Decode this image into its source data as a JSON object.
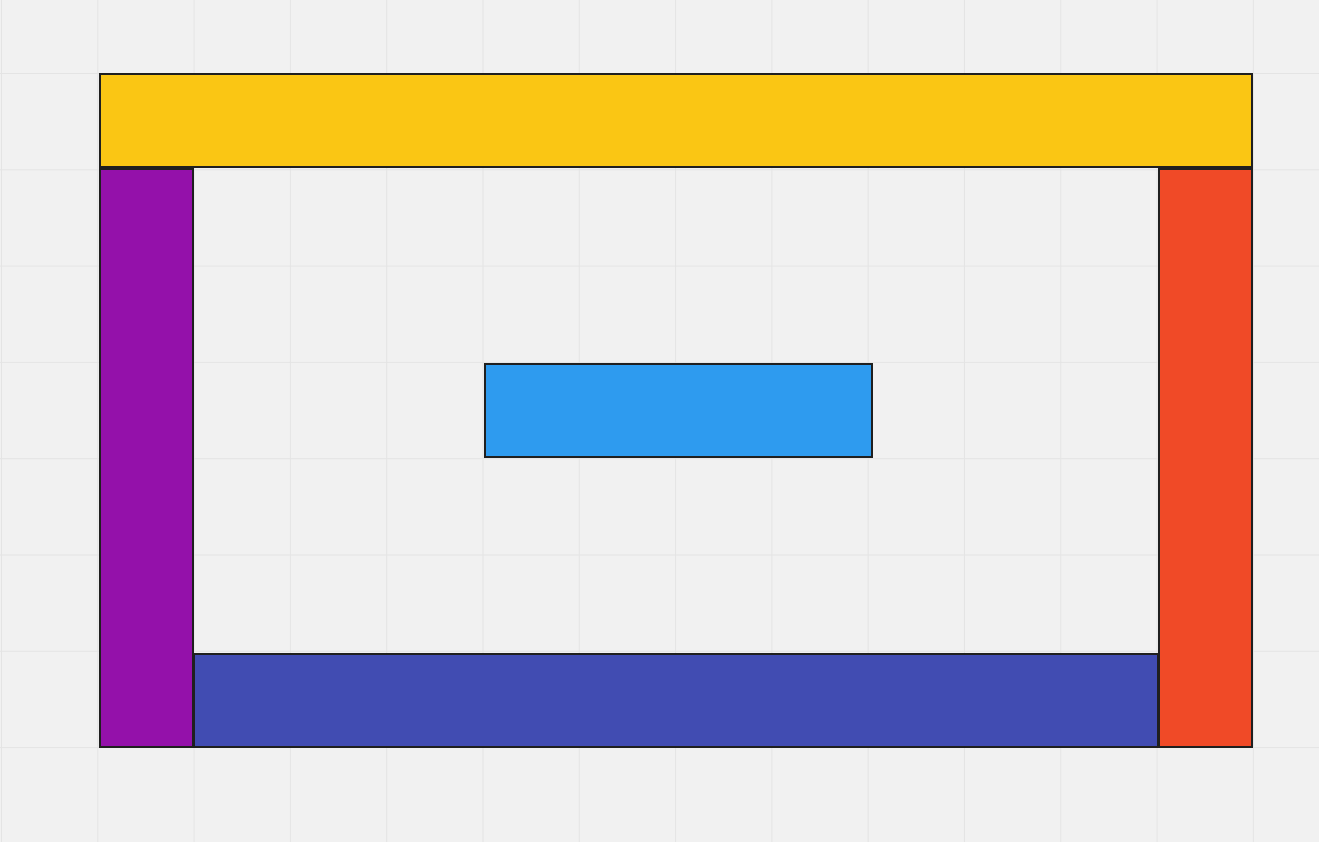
{
  "canvas": {
    "background": "#f1f1f1",
    "grid_color": "#e4e4e4",
    "grid": true
  },
  "blocks": {
    "yellow": {
      "color": "#fac614"
    },
    "purple": {
      "color": "#9411aa"
    },
    "red": {
      "color": "#f04a27"
    },
    "indigo": {
      "color": "#414cb2"
    },
    "blue": {
      "color": "#2e9bef"
    }
  }
}
